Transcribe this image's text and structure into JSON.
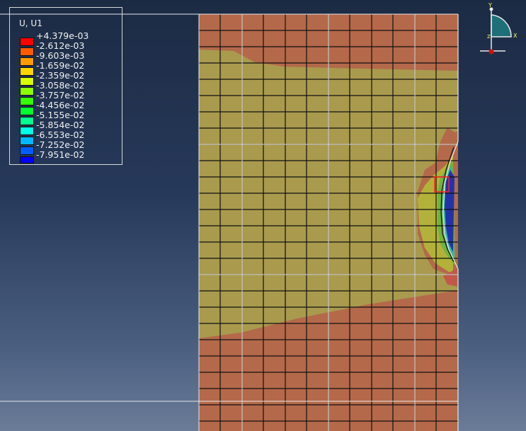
{
  "viewport": {
    "name": "Abaqus Viewport",
    "background_top": "#1c2b44",
    "background_bottom": "#6b7c98"
  },
  "legend": {
    "title": "U, U1",
    "entries": [
      {
        "label": "+4.379e-03",
        "color": "#ff0000"
      },
      {
        "label": "-2.612e-03",
        "color": "#ff5a00"
      },
      {
        "label": "-9.603e-03",
        "color": "#ff9b00"
      },
      {
        "label": "-1.659e-02",
        "color": "#ffd500"
      },
      {
        "label": "-2.359e-02",
        "color": "#d8ff00"
      },
      {
        "label": "-3.058e-02",
        "color": "#8cff00"
      },
      {
        "label": "-3.757e-02",
        "color": "#35ff00"
      },
      {
        "label": "-4.456e-02",
        "color": "#00ff30"
      },
      {
        "label": "-5.155e-02",
        "color": "#00ff8f"
      },
      {
        "label": "-5.854e-02",
        "color": "#00ffe6"
      },
      {
        "label": "-6.553e-02",
        "color": "#00b8ff"
      },
      {
        "label": "-7.252e-02",
        "color": "#005eff"
      },
      {
        "label": "-7.951e-02",
        "color": "#0000ff"
      }
    ]
  },
  "contour_colors": {
    "red_orange": "#b4694a",
    "olive": "#a99a4e",
    "yellow_green": "#b2b23a",
    "green": "#72b23a",
    "blue": "#2233aa",
    "mesh_line": "#101010",
    "edge_line": "#e8e8e8",
    "selected": "#ff2020"
  },
  "triad": {
    "y_label": "Y",
    "x_label": "X",
    "z_label": "Z"
  }
}
